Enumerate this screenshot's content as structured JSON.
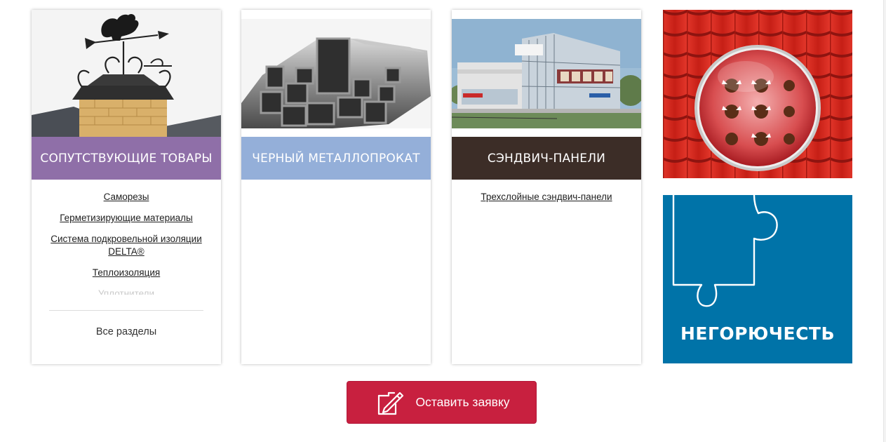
{
  "cards": [
    {
      "title": "СОПУТСТВУЮЩИЕ ТОВАРЫ",
      "links": [
        "Саморезы",
        "Герметизирующие материалы",
        "Система подкровельной изоляции DELTA®",
        "Теплоизоляция",
        "Уплотнители"
      ],
      "all_label": "Все разделы",
      "image_icon": "chimney-weathervane-image"
    },
    {
      "title": "ЧЕРНЫЙ МЕТАЛЛОПРОКАТ",
      "links": [],
      "image_icon": "steel-profile-pipes-image"
    },
    {
      "title": "СЭНДВИЧ-ПАНЕЛИ",
      "links": [
        "Трехслойные сэндвич-панели"
      ],
      "image_icon": "warehouse-building-image"
    }
  ],
  "promos": [
    {
      "image_icon": "red-roof-bull-lens-image"
    },
    {
      "label": "НЕГОРЮЧЕСТЬ",
      "image_icon": "puzzle-piece-outline"
    }
  ],
  "cta": {
    "label": "Оставить заявку",
    "icon": "edit-form-icon",
    "color": "#c8203f"
  },
  "colors": {
    "card1_title_bg": "#8f6fa8",
    "card2_title_bg": "#94afd9",
    "card3_title_bg": "#3c2d27",
    "promo2_bg": "#0073a8"
  }
}
